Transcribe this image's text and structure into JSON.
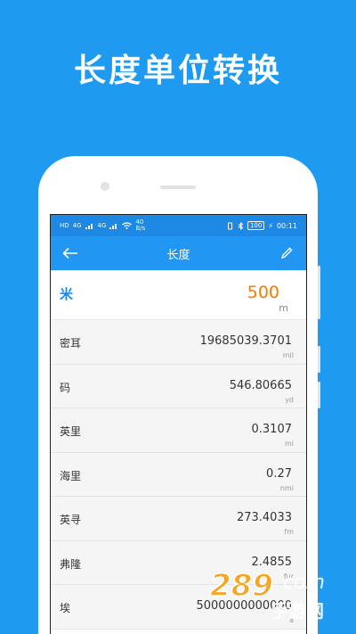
{
  "promo": {
    "title": "长度单位转换"
  },
  "status": {
    "hd1": "HD",
    "hd2": "HD",
    "net1": "4G",
    "net2": "4G",
    "speed": "40",
    "speed_unit": "B/s",
    "battery": "100",
    "time": "00:11"
  },
  "appbar": {
    "title": "长度"
  },
  "main": {
    "name": "米",
    "value": "500",
    "unit": "m"
  },
  "rows": [
    {
      "name": "密耳",
      "value": "19685039.3701",
      "unit": "mil"
    },
    {
      "name": "码",
      "value": "546.80665",
      "unit": "yd"
    },
    {
      "name": "英里",
      "value": "0.3107",
      "unit": "mi"
    },
    {
      "name": "海里",
      "value": "0.27",
      "unit": "nmi"
    },
    {
      "name": "英寻",
      "value": "273.4033",
      "unit": "fm"
    },
    {
      "name": "弗隆",
      "value": "2.4855",
      "unit": "fur"
    },
    {
      "name": "埃",
      "value": "5000000000000",
      "unit": "a"
    }
  ],
  "watermark": {
    "number": "289",
    "suffix": "com",
    "text": "手游网"
  },
  "icons": {
    "back": "arrow-left-icon",
    "edit": "pencil-icon"
  },
  "colors": {
    "background": "#1e9bf0",
    "appbar": "#2196f3",
    "accent": "#1e88e5",
    "value": "#f57c00"
  }
}
